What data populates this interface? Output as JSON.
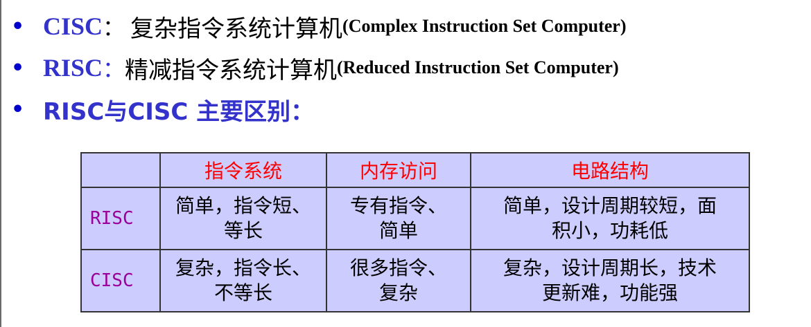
{
  "bullets": [
    {
      "term": "CISC",
      "sep": " ：",
      "cn": "复杂指令系统计算机",
      "en": "(Complex Instruction Set Computer)"
    },
    {
      "term": "RISC",
      "sep": "：",
      "cn": "精减指令系统计算机",
      "en": "(Reduced Instruction Set Computer)"
    },
    {
      "heading": "RISC与CISC 主要区别："
    }
  ],
  "table": {
    "headers": [
      "指令系统",
      "内存访问",
      "电路结构"
    ],
    "rows": [
      {
        "label": "RISC",
        "cells": [
          [
            "简单，指令短、",
            "等长"
          ],
          [
            "专有指令、",
            "简单"
          ],
          [
            "简单，设计周期较短，面",
            "积小，功耗低"
          ]
        ]
      },
      {
        "label": "CISC",
        "cells": [
          [
            "复杂，指令长、",
            "不等长"
          ],
          [
            "很多指令、",
            "复杂"
          ],
          [
            "复杂，设计周期长，技术",
            "更新难，功能强"
          ]
        ]
      }
    ]
  },
  "colors": {
    "term_blue": "#3333cc",
    "header_red": "#ff0000",
    "label_purple": "#990099",
    "table_bg": "#ccccff"
  }
}
